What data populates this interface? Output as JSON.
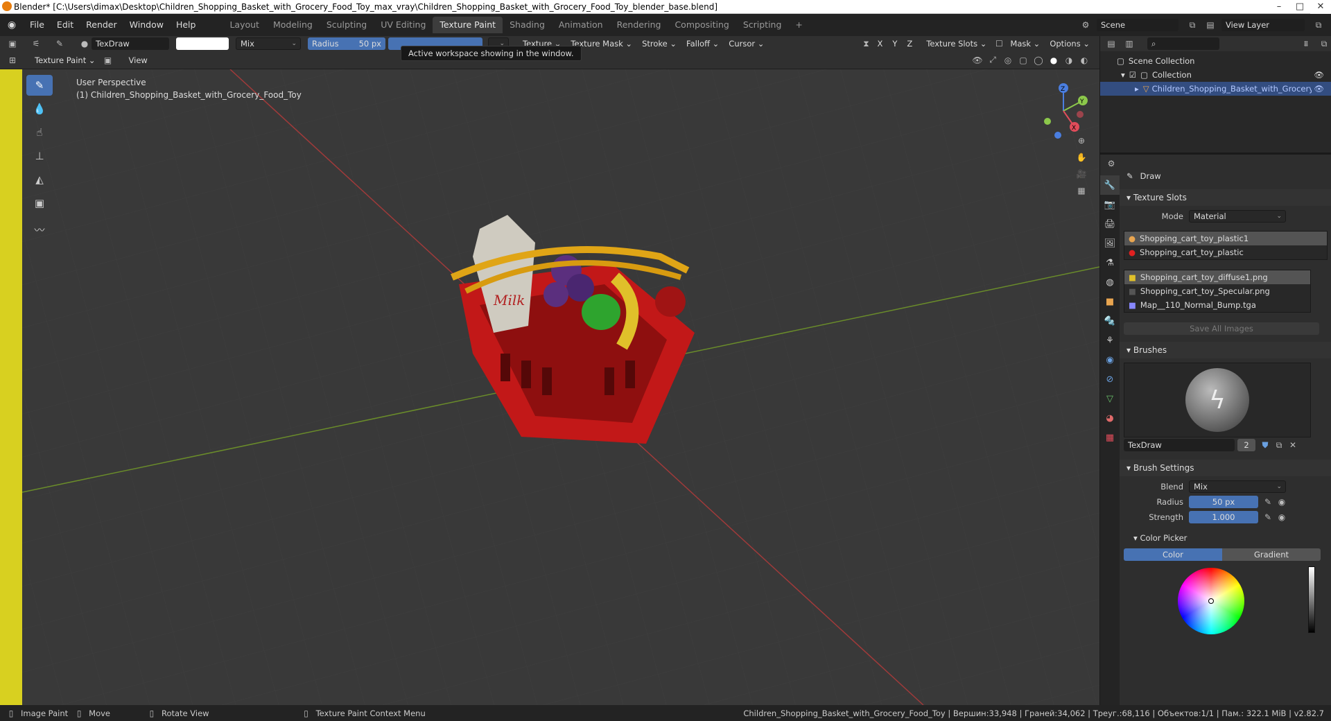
{
  "window": {
    "title": "Blender* [C:\\Users\\dimax\\Desktop\\Children_Shopping_Basket_with_Grocery_Food_Toy_max_vray\\Children_Shopping_Basket_with_Grocery_Food_Toy_blender_base.blend]"
  },
  "menu": [
    "File",
    "Edit",
    "Render",
    "Window",
    "Help"
  ],
  "workspaces": [
    "Layout",
    "Modeling",
    "Sculpting",
    "UV Editing",
    "Texture Paint",
    "Shading",
    "Animation",
    "Rendering",
    "Compositing",
    "Scripting"
  ],
  "active_workspace": "Texture Paint",
  "scene": {
    "scene_name": "Scene",
    "view_layer": "View Layer"
  },
  "tool_header": {
    "brush_name": "TexDraw",
    "blend": "Mix",
    "radius_label": "Radius",
    "radius_value": "50 px",
    "dropdowns": [
      "Texture",
      "Texture Mask",
      "Stroke",
      "Falloff",
      "Cursor"
    ],
    "axes": [
      "X",
      "Y",
      "Z"
    ],
    "texture_slots": "Texture Slots",
    "mask": "Mask",
    "options": "Options"
  },
  "editor_header": {
    "mode": "Texture Paint",
    "view": "View"
  },
  "tooltip": "Active workspace showing in the window.",
  "viewport": {
    "perspective": "User Perspective",
    "object": "(1) Children_Shopping_Basket_with_Grocery_Food_Toy",
    "milk_label": "Milk",
    "gizmo_axes": [
      "X",
      "Y",
      "Z"
    ]
  },
  "outliner": {
    "root": "Scene Collection",
    "collection": "Collection",
    "object": "Children_Shopping_Basket_with_Grocery_Food_Toy"
  },
  "properties": {
    "tool_name": "Draw",
    "texture_slots_title": "Texture Slots",
    "mode_label": "Mode",
    "mode_value": "Material",
    "materials": [
      "Shopping_cart_toy_plastic1",
      "Shopping_cart_toy_plastic"
    ],
    "images": [
      "Shopping_cart_toy_diffuse1.png",
      "Shopping_cart_toy_Specular.png",
      "Map__110_Normal_Bump.tga"
    ],
    "save_all": "Save All Images",
    "brushes_title": "Brushes",
    "brush_name": "TexDraw",
    "brush_users": "2",
    "brush_settings_title": "Brush Settings",
    "blend_label": "Blend",
    "blend_value": "Mix",
    "radius_label": "Radius",
    "radius_value": "50 px",
    "strength_label": "Strength",
    "strength_value": "1.000",
    "color_picker_title": "Color Picker",
    "color_tab": "Color",
    "gradient_tab": "Gradient"
  },
  "statusbar": {
    "image_paint": "Image Paint",
    "move": "Move",
    "rotate": "Rotate View",
    "context": "Texture Paint Context Menu",
    "stats": "Children_Shopping_Basket_with_Grocery_Food_Toy | Вершин:33,948 | Граней:34,062 | Треуг.:68,116 | Объектов:1/1 | Пам.: 322.1 MiB | v2.82.7"
  }
}
